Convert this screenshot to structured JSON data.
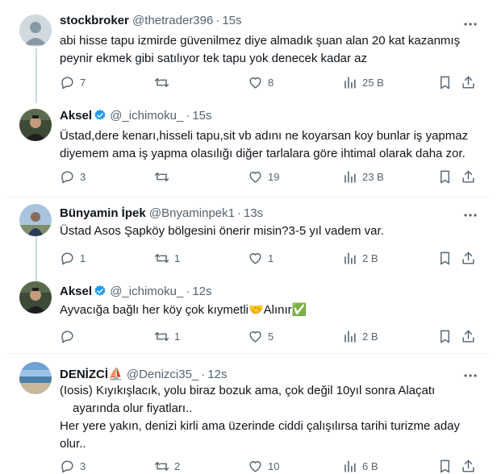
{
  "tweets": [
    {
      "name": "stockbroker",
      "handle": "@thetrader396",
      "time": "15s",
      "verified": false,
      "body": [
        "abi hisse tapu izmirde güvenilmez diye almadık şuan alan 20 kat kazanmış",
        "peynir ekmek gibi satılıyor tek tapu yok denecek kadar az"
      ],
      "replies": "7",
      "retweets": "",
      "likes": "8",
      "views": "25 B"
    },
    {
      "name": "Aksel",
      "handle": "@_ichimoku_",
      "time": "15s",
      "verified": true,
      "body": [
        "Üstad,dere kenarı,hisseli tapu,sit vb adını ne koyarsan koy bunlar iş yapmaz",
        "diyemem ama iş yapma olasılığı diğer tarlalara göre ihtimal olarak daha zor."
      ],
      "replies": "3",
      "retweets": "",
      "likes": "19",
      "views": "23 B"
    },
    {
      "name": "Bünyamin İpek",
      "handle": "@Bnyaminpek1",
      "time": "13s",
      "verified": false,
      "body": [
        "Üstad Asos Şapköy bölgesini önerir misin?3-5 yıl vadem var."
      ],
      "replies": "1",
      "retweets": "1",
      "likes": "1",
      "views": "2 B"
    },
    {
      "name": "Aksel",
      "handle": "@_ichimoku_",
      "time": "12s",
      "verified": true,
      "body": [
        "Ayvacığa bağlı her köy çok kıymetli🤝Alınır✅"
      ],
      "replies": "",
      "retweets": "1",
      "likes": "5",
      "views": "2 B"
    },
    {
      "name": "DENİZCİ⛵",
      "handle": "@Denizci35_",
      "time": "12s",
      "verified": false,
      "body": [
        "(Iosis) Kıyıkışlacık, yolu biraz bozuk ama, çok değil 10yıl sonra Alaçatı",
        "ayarında olur fiyatları..",
        "Her yere yakın, denizi kirli ama üzerinde ciddi çalışılırsa tarihi turizme aday",
        "olur.."
      ],
      "replies": "3",
      "retweets": "2",
      "likes": "10",
      "views": "6 B"
    }
  ],
  "icons": {
    "reply": "reply-icon",
    "retweet": "retweet-icon",
    "like": "like-icon",
    "views": "views-icon",
    "bookmark": "bookmark-icon",
    "share": "share-icon",
    "more": "more-icon",
    "verified": "verified-badge-icon"
  },
  "colors": {
    "verified": "#1d9bf0",
    "secondary": "#536471"
  }
}
